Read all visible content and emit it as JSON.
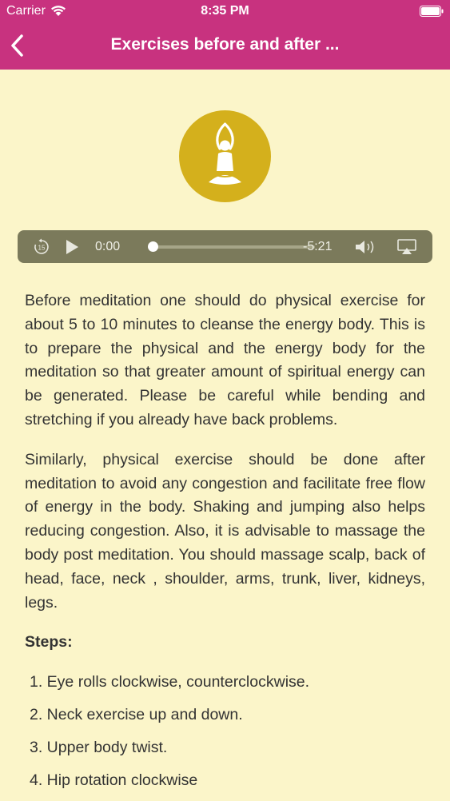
{
  "status_bar": {
    "carrier": "Carrier",
    "time": "8:35 PM"
  },
  "nav": {
    "title": "Exercises before and after ...",
    "back_icon": "chevron-left-icon"
  },
  "hero": {
    "icon": "meditation-pose-icon",
    "color": "#d4b01c"
  },
  "player": {
    "current_time": "0:00",
    "remaining_time": "-5:21",
    "progress": 0,
    "icons": [
      "rewind-15-icon",
      "play-icon",
      "volume-icon",
      "airplay-icon"
    ]
  },
  "article": {
    "paragraphs": [
      "Before meditation one should do physical exercise for about 5 to 10 minutes to cleanse the energy body. This is to prepare the physical and the energy body for the meditation so that greater amount of spiritual energy can be generated. Please be careful while bending and stretching if you already have back problems.",
      "Similarly, physical exercise should be done after meditation to avoid any congestion and facilitate free flow of energy in the body. Shaking and jumping also helps reducing congestion. Also, it is advisable to massage the body post meditation. You should massage scalp, back of head, face, neck , shoulder, arms, trunk, liver, kidneys, legs."
    ],
    "steps_heading": "Steps:",
    "steps": [
      "1. Eye rolls clockwise, counterclockwise.",
      "2. Neck exercise up and down.",
      "3. Upper body twist.",
      "4. Hip rotation clockwise"
    ]
  },
  "colors": {
    "header": "#c8327f",
    "background": "#fbf5c9",
    "player": "#7b7a5b"
  }
}
